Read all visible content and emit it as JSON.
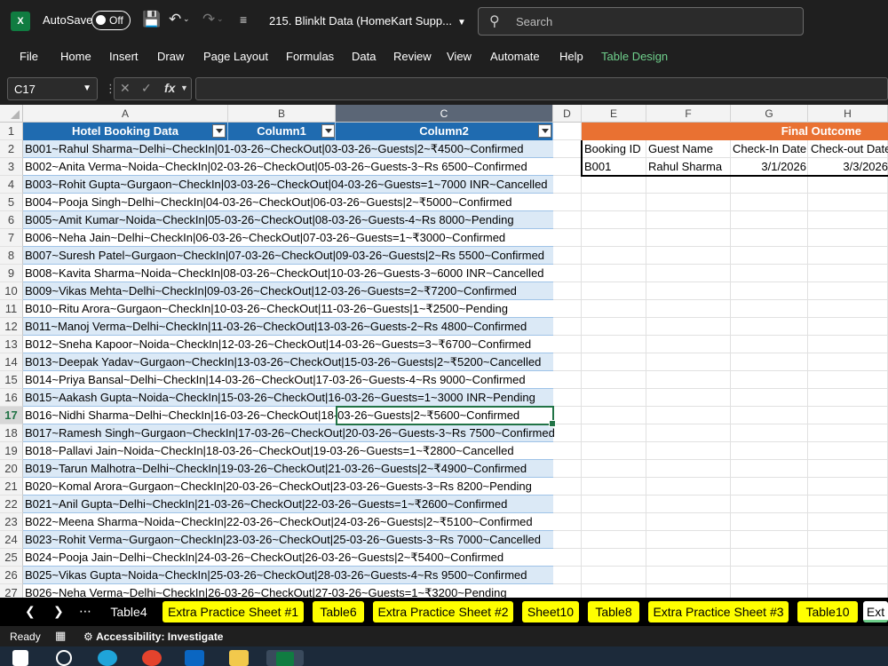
{
  "titlebar": {
    "logo": "X",
    "autosave_label": "AutoSave",
    "toggle_state": "Off",
    "filename": "215. Blinklt Data (HomeKart Supp...",
    "search_placeholder": "Search"
  },
  "menu": [
    "File",
    "Home",
    "Insert",
    "Draw",
    "Page Layout",
    "Formulas",
    "Data",
    "Review",
    "View",
    "Automate",
    "Help",
    "Table Design"
  ],
  "formula_bar": {
    "name_box": "C17",
    "fx": "fx"
  },
  "columns": [
    "A",
    "B",
    "C",
    "D",
    "E",
    "F",
    "G",
    "H"
  ],
  "table": {
    "headers": [
      "Hotel Booking Data",
      "Column1",
      "Column2"
    ],
    "rows": [
      "B001~Rahul Sharma~Delhi~CheckIn|01-03-26~CheckOut|03-03-26~Guests|2~₹4500~Confirmed",
      "B002~Anita Verma~Noida~CheckIn|02-03-26~CheckOut|05-03-26~Guests-3~Rs 6500~Confirmed",
      "B003~Rohit Gupta~Gurgaon~CheckIn|03-03-26~CheckOut|04-03-26~Guests=1~7000 INR~Cancelled",
      "B004~Pooja Singh~Delhi~CheckIn|04-03-26~CheckOut|06-03-26~Guests|2~₹5000~Confirmed",
      "B005~Amit Kumar~Noida~CheckIn|05-03-26~CheckOut|08-03-26~Guests-4~Rs 8000~Pending",
      "B006~Neha Jain~Delhi~CheckIn|06-03-26~CheckOut|07-03-26~Guests=1~₹3000~Confirmed",
      "B007~Suresh Patel~Gurgaon~CheckIn|07-03-26~CheckOut|09-03-26~Guests|2~Rs 5500~Confirmed",
      "B008~Kavita Sharma~Noida~CheckIn|08-03-26~CheckOut|10-03-26~Guests-3~6000 INR~Cancelled",
      "B009~Vikas Mehta~Delhi~CheckIn|09-03-26~CheckOut|12-03-26~Guests=2~₹7200~Confirmed",
      "B010~Ritu Arora~Gurgaon~CheckIn|10-03-26~CheckOut|11-03-26~Guests|1~₹2500~Pending",
      "B011~Manoj Verma~Delhi~CheckIn|11-03-26~CheckOut|13-03-26~Guests-2~Rs 4800~Confirmed",
      "B012~Sneha Kapoor~Noida~CheckIn|12-03-26~CheckOut|14-03-26~Guests=3~₹6700~Confirmed",
      "B013~Deepak Yadav~Gurgaon~CheckIn|13-03-26~CheckOut|15-03-26~Guests|2~₹5200~Cancelled",
      "B014~Priya Bansal~Delhi~CheckIn|14-03-26~CheckOut|17-03-26~Guests-4~Rs 9000~Confirmed",
      "B015~Aakash Gupta~Noida~CheckIn|15-03-26~CheckOut|16-03-26~Guests=1~3000 INR~Pending",
      "B016~Nidhi Sharma~Delhi~CheckIn|16-03-26~CheckOut|18-03-26~Guests|2~₹5600~Confirmed",
      "B017~Ramesh Singh~Gurgaon~CheckIn|17-03-26~CheckOut|20-03-26~Guests-3~Rs 7500~Confirmed",
      "B018~Pallavi Jain~Noida~CheckIn|18-03-26~CheckOut|19-03-26~Guests=1~₹2800~Cancelled",
      "B019~Tarun Malhotra~Delhi~CheckIn|19-03-26~CheckOut|21-03-26~Guests|2~₹4900~Confirmed",
      "B020~Komal Arora~Gurgaon~CheckIn|20-03-26~CheckOut|23-03-26~Guests-3~Rs 8200~Pending",
      "B021~Anil Gupta~Delhi~CheckIn|21-03-26~CheckOut|22-03-26~Guests=1~₹2600~Confirmed",
      "B022~Meena Sharma~Noida~CheckIn|22-03-26~CheckOut|24-03-26~Guests|2~₹5100~Confirmed",
      "B023~Rohit Verma~Gurgaon~CheckIn|23-03-26~CheckOut|25-03-26~Guests-3~Rs 7000~Cancelled",
      "B024~Pooja Jain~Delhi~CheckIn|24-03-26~CheckOut|26-03-26~Guests|2~₹5400~Confirmed",
      "B025~Vikas Gupta~Noida~CheckIn|25-03-26~CheckOut|28-03-26~Guests-4~Rs 9500~Confirmed",
      "B026~Neha Verma~Delhi~CheckIn|26-03-26~CheckOut|27-03-26~Guests=1~₹3200~Pending"
    ]
  },
  "final_outcome": {
    "title": "Final Outcome",
    "headers": [
      "Booking ID",
      "Guest Name",
      "Check-In Date",
      "Check-out Date"
    ],
    "values": [
      "B001",
      "Rahul Sharma",
      "3/1/2026",
      "3/3/2026"
    ]
  },
  "sheet_tabs": [
    {
      "label": "Table4",
      "style": "plain"
    },
    {
      "label": "Extra Practice Sheet #1",
      "style": "yellow"
    },
    {
      "label": "Table6",
      "style": "yellow"
    },
    {
      "label": "Extra Practice Sheet #2",
      "style": "yellow"
    },
    {
      "label": "Sheet10",
      "style": "yellow"
    },
    {
      "label": "Table8",
      "style": "yellow"
    },
    {
      "label": "Extra Practice Sheet #3",
      "style": "yellow"
    },
    {
      "label": "Table10",
      "style": "yellow"
    },
    {
      "label": "Ext",
      "style": "active"
    }
  ],
  "status": {
    "ready": "Ready",
    "accessibility": "Accessibility: Investigate"
  },
  "colors": {
    "table_header": "#1f6bb0",
    "band": "#dbe9f6",
    "outcome_header": "#e97132",
    "accent": "#217346",
    "tab_yellow": "#ffff00"
  }
}
